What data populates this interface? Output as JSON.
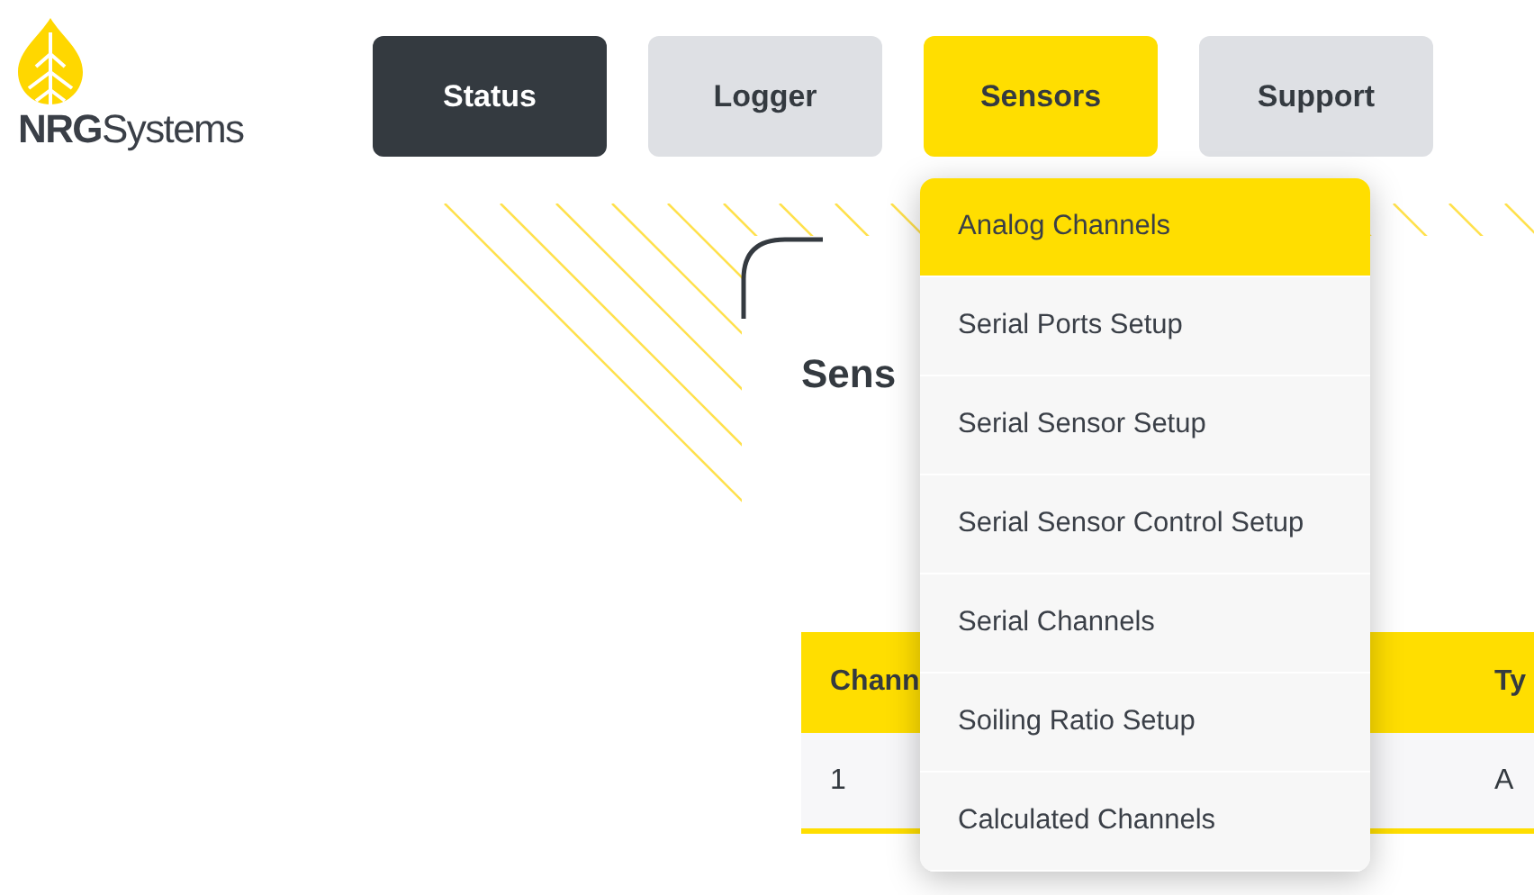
{
  "logo": {
    "wordmark": "**NRG**Systems"
  },
  "nav": [
    {
      "label": "Status",
      "selected": false,
      "focused": true
    },
    {
      "label": "Logger",
      "selected": false,
      "focused": false
    },
    {
      "label": "Sensors",
      "selected": true,
      "focused": false
    },
    {
      "label": "Support",
      "selected": false,
      "focused": false
    }
  ],
  "page": {
    "heading": "Sens"
  },
  "table": {
    "columns": [
      "Chann",
      "Ty"
    ],
    "rows": [
      [
        "1",
        "A"
      ]
    ]
  },
  "dropdown": {
    "items": [
      {
        "label": "Analog Channels",
        "selected": true
      },
      {
        "label": "Serial Ports Setup",
        "selected": false
      },
      {
        "label": "Serial Sensor Setup",
        "selected": false
      },
      {
        "label": "Serial Sensor Control Setup",
        "selected": false
      },
      {
        "label": "Serial Channels",
        "selected": false
      },
      {
        "label": "Soiling Ratio Setup",
        "selected": false
      },
      {
        "label": "Calculated Channels",
        "selected": false
      }
    ]
  }
}
